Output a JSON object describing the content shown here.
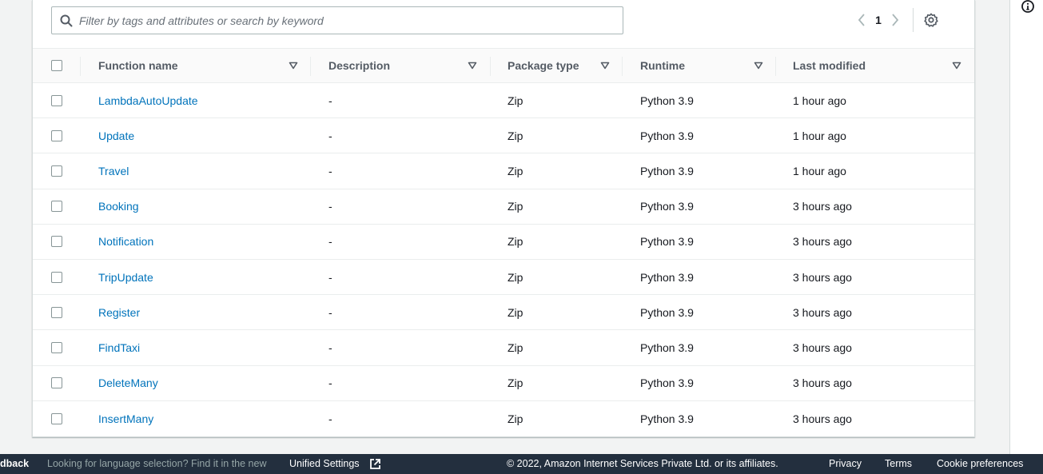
{
  "filter": {
    "placeholder": "Filter by tags and attributes or search by keyword"
  },
  "pagination": {
    "current_page": "1"
  },
  "table": {
    "headers": {
      "function_name": "Function name",
      "description": "Description",
      "package_type": "Package type",
      "runtime": "Runtime",
      "last_modified": "Last modified"
    },
    "rows": [
      {
        "name": "LambdaAutoUpdate",
        "description": "-",
        "package_type": "Zip",
        "runtime": "Python 3.9",
        "last_modified": "1 hour ago"
      },
      {
        "name": "Update",
        "description": "-",
        "package_type": "Zip",
        "runtime": "Python 3.9",
        "last_modified": "1 hour ago"
      },
      {
        "name": "Travel",
        "description": "-",
        "package_type": "Zip",
        "runtime": "Python 3.9",
        "last_modified": "1 hour ago"
      },
      {
        "name": "Booking",
        "description": "-",
        "package_type": "Zip",
        "runtime": "Python 3.9",
        "last_modified": "3 hours ago"
      },
      {
        "name": "Notification",
        "description": "-",
        "package_type": "Zip",
        "runtime": "Python 3.9",
        "last_modified": "3 hours ago"
      },
      {
        "name": "TripUpdate",
        "description": "-",
        "package_type": "Zip",
        "runtime": "Python 3.9",
        "last_modified": "3 hours ago"
      },
      {
        "name": "Register",
        "description": "-",
        "package_type": "Zip",
        "runtime": "Python 3.9",
        "last_modified": "3 hours ago"
      },
      {
        "name": "FindTaxi",
        "description": "-",
        "package_type": "Zip",
        "runtime": "Python 3.9",
        "last_modified": "3 hours ago"
      },
      {
        "name": "DeleteMany",
        "description": "-",
        "package_type": "Zip",
        "runtime": "Python 3.9",
        "last_modified": "3 hours ago"
      },
      {
        "name": "InsertMany",
        "description": "-",
        "package_type": "Zip",
        "runtime": "Python 3.9",
        "last_modified": "3 hours ago"
      }
    ]
  },
  "footer": {
    "feedback": "dback",
    "language_prompt": "Looking for language selection? Find it in the new",
    "unified_settings": "Unified Settings",
    "copyright": "© 2022, Amazon Internet Services Private Ltd. or its affiliates.",
    "privacy": "Privacy",
    "terms": "Terms",
    "cookie_preferences": "Cookie preferences"
  },
  "icons": {
    "search": "search-icon",
    "prev": "chevron-left-icon",
    "next": "chevron-right-icon",
    "settings": "gear-icon",
    "sort": "caret-down-icon",
    "external": "external-link-icon",
    "info": "info-icon"
  },
  "colors": {
    "link": "#0073bb",
    "footer_bg": "#232f3e",
    "header_text": "#545b64"
  }
}
